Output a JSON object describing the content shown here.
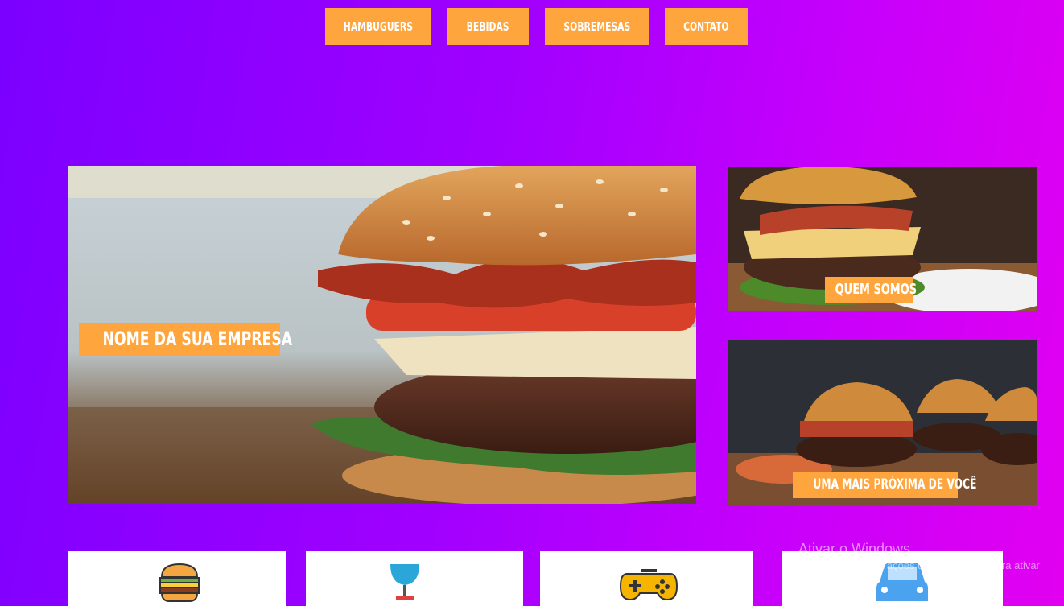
{
  "nav": {
    "items": [
      "HAMBUGUERS",
      "BEBIDAS",
      "SOBREMESAS",
      "CONTATO"
    ]
  },
  "hero": {
    "title": "NOME DA SUA EMPRESA"
  },
  "side_cards": [
    {
      "title": "QUEM SOMOS"
    },
    {
      "title": "UMA MAIS PRÓXIMA DE VOCÊ"
    }
  ],
  "category_cards": [
    {
      "icon": "burger-icon"
    },
    {
      "icon": "drink-glass-icon"
    },
    {
      "icon": "gamepad-icon"
    },
    {
      "icon": "car-icon"
    }
  ],
  "watermark": {
    "title": "Ativar o Windows",
    "text": "Acesse as configurações do computador para ativar o Windows."
  },
  "colors": {
    "accent": "#ffa53d",
    "bg_start": "#7b00ff",
    "bg_end": "#e200f0"
  }
}
